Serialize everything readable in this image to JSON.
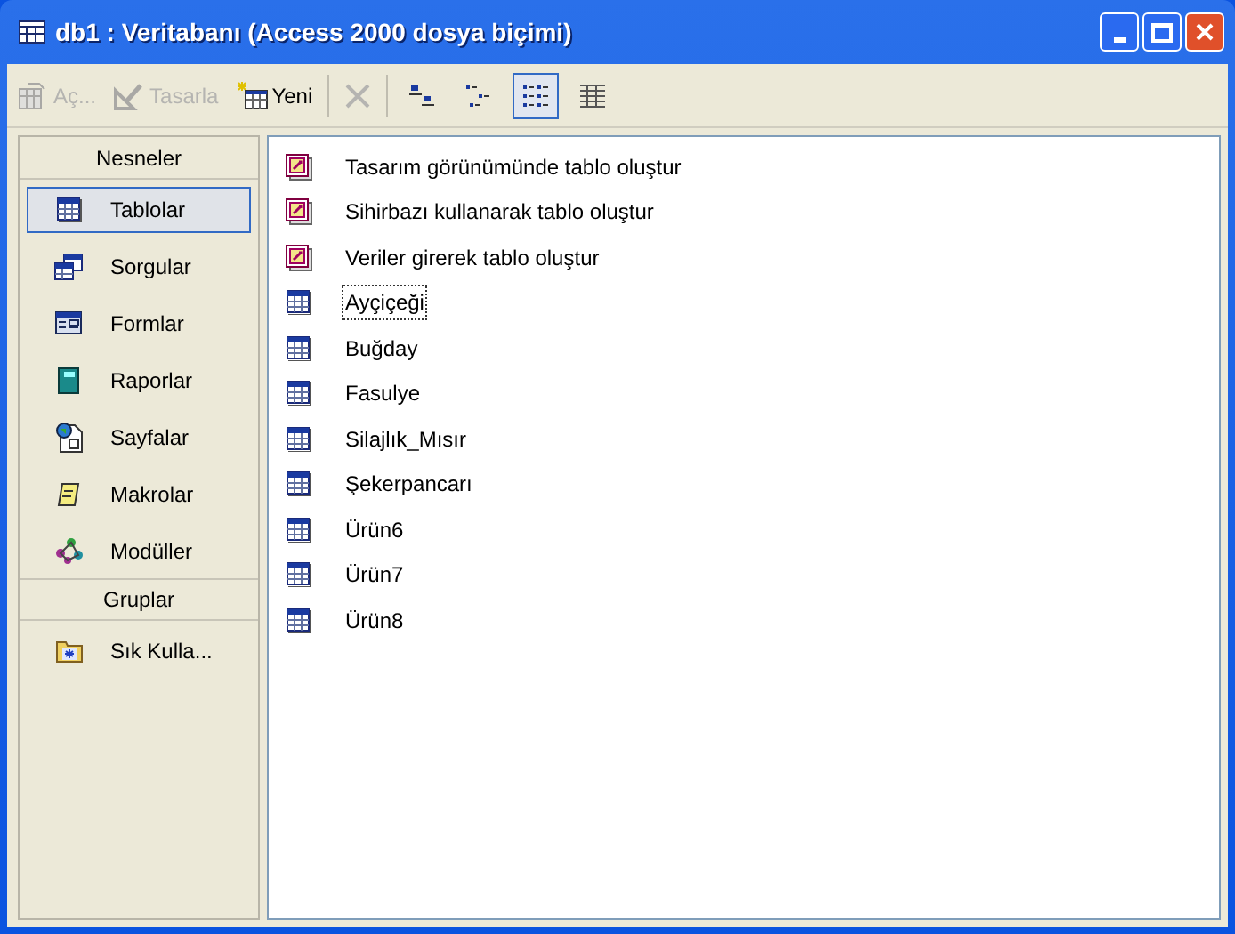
{
  "window": {
    "title": "db1 : Veritabanı (Access 2000 dosya biçimi)"
  },
  "toolbar": {
    "actions": [
      {
        "kind": "open",
        "label": "Aç...",
        "disabled": true
      },
      {
        "kind": "design",
        "label": "Tasarla",
        "disabled": true
      },
      {
        "kind": "new",
        "label": "Yeni",
        "disabled": false
      },
      {
        "kind": "delete",
        "disabled": true
      }
    ],
    "views": [
      {
        "kind": "large",
        "selected": false
      },
      {
        "kind": "small",
        "selected": false
      },
      {
        "kind": "list",
        "selected": true
      },
      {
        "kind": "details",
        "selected": false
      }
    ]
  },
  "sidebar": {
    "sections": [
      {
        "title": "Nesneler",
        "items": [
          {
            "kind": "table",
            "label": "Tablolar",
            "selected": true
          },
          {
            "kind": "query",
            "label": "Sorgular",
            "selected": false
          },
          {
            "kind": "form",
            "label": "Formlar",
            "selected": false
          },
          {
            "kind": "report",
            "label": "Raporlar",
            "selected": false
          },
          {
            "kind": "page",
            "label": "Sayfalar",
            "selected": false
          },
          {
            "kind": "macro",
            "label": "Makrolar",
            "selected": false
          },
          {
            "kind": "module",
            "label": "Modüller",
            "selected": false
          }
        ]
      },
      {
        "title": "Gruplar",
        "items": [
          {
            "kind": "favorites",
            "label": "Sık Kulla...",
            "selected": false
          }
        ]
      }
    ]
  },
  "objects": [
    {
      "kind": "wizard",
      "label": "Tasarım görünümünde tablo oluştur",
      "selected": false
    },
    {
      "kind": "wizard",
      "label": "Sihirbazı kullanarak tablo oluştur",
      "selected": false
    },
    {
      "kind": "wizard",
      "label": "Veriler girerek tablo oluştur",
      "selected": false
    },
    {
      "kind": "table",
      "label": "Ayçiçeği",
      "selected": true
    },
    {
      "kind": "table",
      "label": "Buğday",
      "selected": false
    },
    {
      "kind": "table",
      "label": "Fasulye",
      "selected": false
    },
    {
      "kind": "table",
      "label": "Silajlık_Mısır",
      "selected": false
    },
    {
      "kind": "table",
      "label": "Şekerpancarı",
      "selected": false
    },
    {
      "kind": "table",
      "label": "Ürün6",
      "selected": false
    },
    {
      "kind": "table",
      "label": "Ürün7",
      "selected": false
    },
    {
      "kind": "table",
      "label": "Ürün8",
      "selected": false
    }
  ]
}
